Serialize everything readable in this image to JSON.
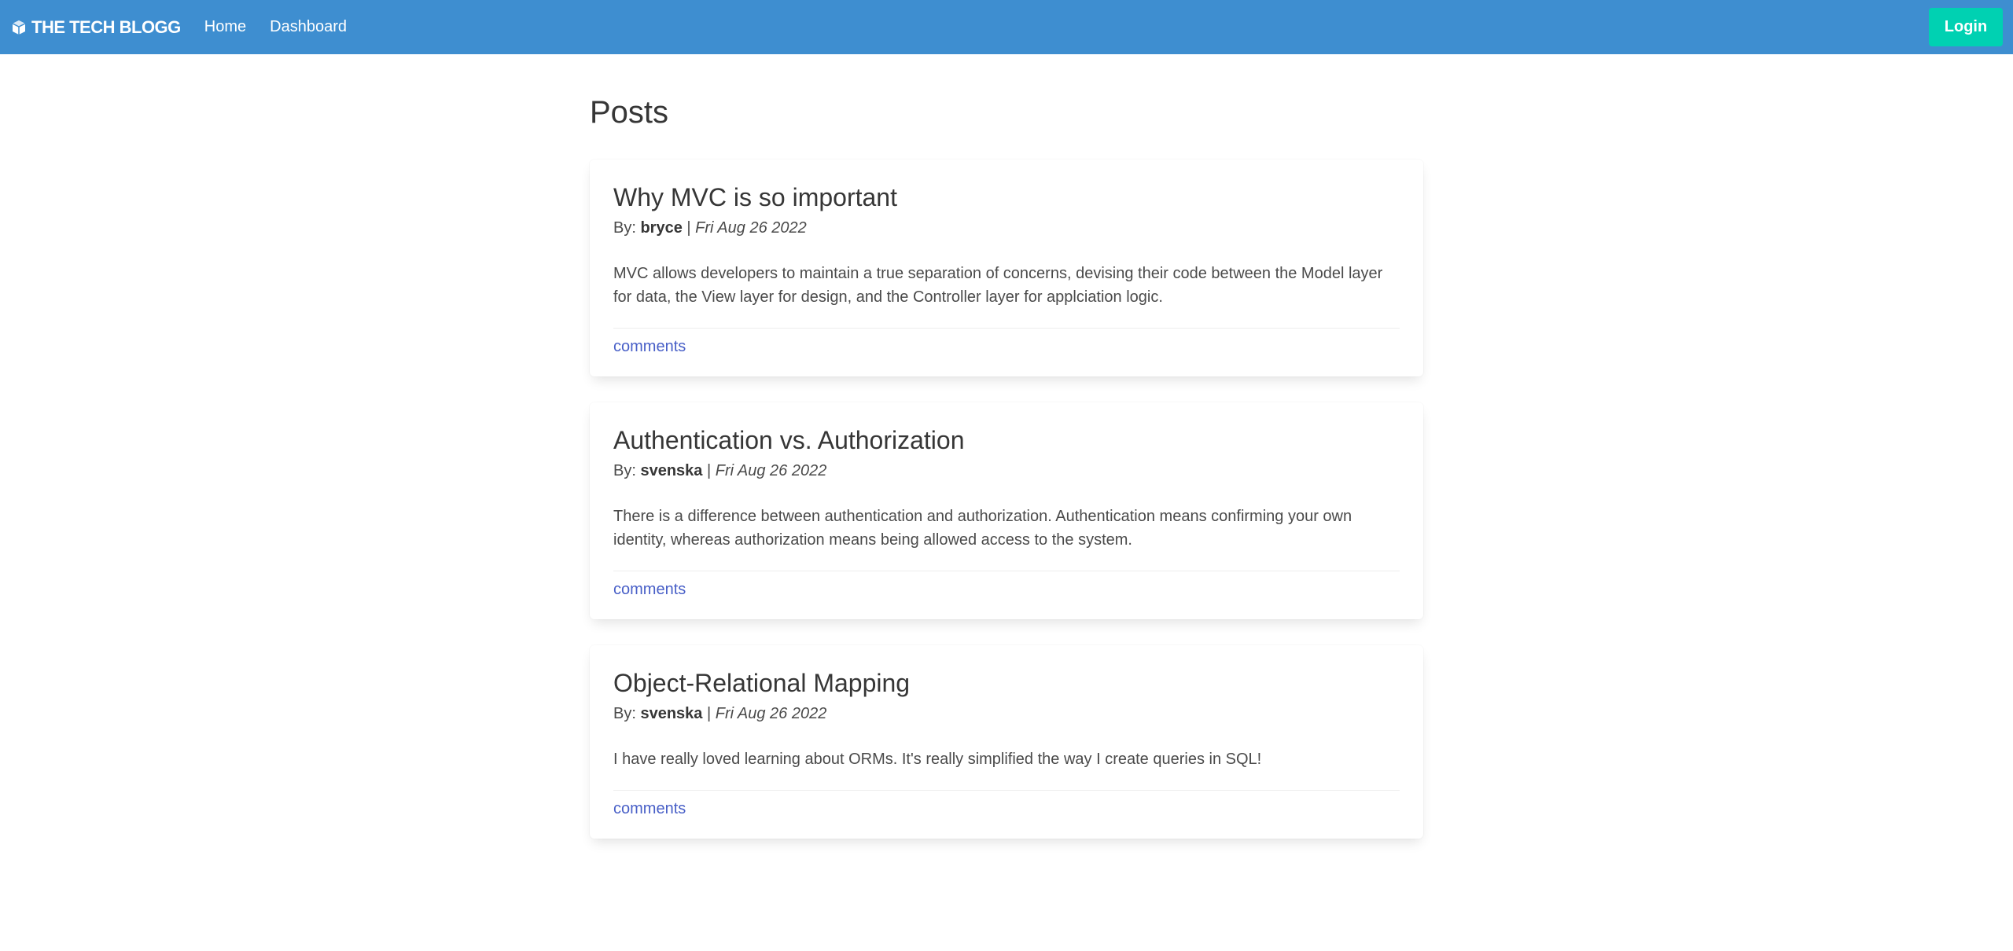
{
  "nav": {
    "brand": "THE TECH BLOGG",
    "links": [
      "Home",
      "Dashboard"
    ],
    "login_label": "Login"
  },
  "main": {
    "title": "Posts",
    "by_prefix": "By:",
    "separator": "|",
    "comments_label": "comments",
    "posts": [
      {
        "title": "Why MVC is so important",
        "author": "bryce",
        "date": "Fri Aug 26 2022",
        "body": "MVC allows developers to maintain a true separation of concerns, devising their code between the Model layer for data, the View layer for design, and the Controller layer for applciation logic."
      },
      {
        "title": "Authentication vs. Authorization",
        "author": "svenska",
        "date": "Fri Aug 26 2022",
        "body": "There is a difference between authentication and authorization. Authentication means confirming your own identity, whereas authorization means being allowed access to the system."
      },
      {
        "title": "Object-Relational Mapping",
        "author": "svenska",
        "date": "Fri Aug 26 2022",
        "body": "I have really loved learning about ORMs. It's really simplified the way I create queries in SQL!"
      }
    ]
  },
  "colors": {
    "navbar": "#3e8ed0",
    "login_button": "#00d1b2",
    "link": "#485fc7"
  },
  "icons": {
    "brand": "cube-icon"
  }
}
